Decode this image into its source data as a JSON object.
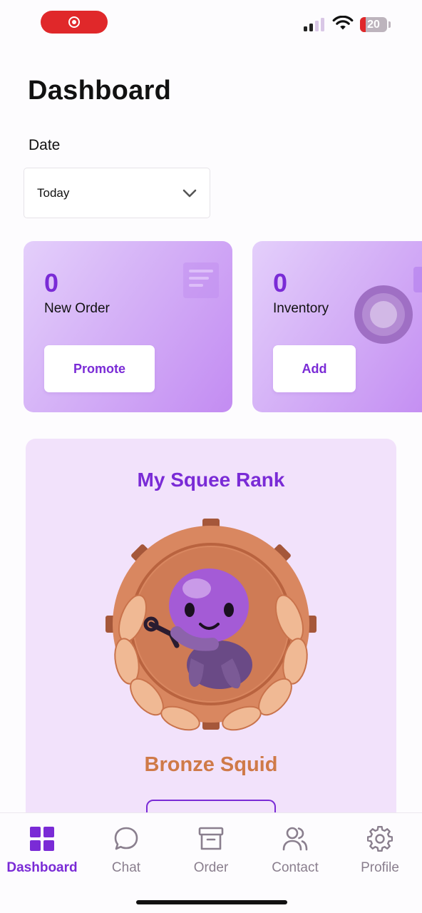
{
  "status_bar": {
    "battery_level": "20",
    "recording": true,
    "signal_bars_on": 2,
    "colors": {
      "recording": "#e0282a",
      "battery_low": "#e0282a"
    }
  },
  "header": {
    "title": "Dashboard"
  },
  "date_filter": {
    "label": "Date",
    "selected": "Today"
  },
  "cards": [
    {
      "value": "0",
      "label": "New Order",
      "button": "Promote",
      "icon": "document-icon"
    },
    {
      "value": "0",
      "label": "Inventory",
      "button": "Add",
      "icon": "box-icon"
    }
  ],
  "rank": {
    "title": "My Squee Rank",
    "name": "Bronze Squid",
    "badge_icon": "bronze-squid-badge"
  },
  "bottom_nav": [
    {
      "label": "Dashboard",
      "icon": "grid-icon",
      "active": true
    },
    {
      "label": "Chat",
      "icon": "chat-bubble-icon",
      "active": false
    },
    {
      "label": "Order",
      "icon": "archive-box-icon",
      "active": false
    },
    {
      "label": "Contact",
      "icon": "users-icon",
      "active": false
    },
    {
      "label": "Profile",
      "icon": "gear-icon",
      "active": false
    }
  ],
  "theme": {
    "accent": "#7a2bd6",
    "bronze": "#cf7a48",
    "panel_bg": "#f2e2fb"
  }
}
